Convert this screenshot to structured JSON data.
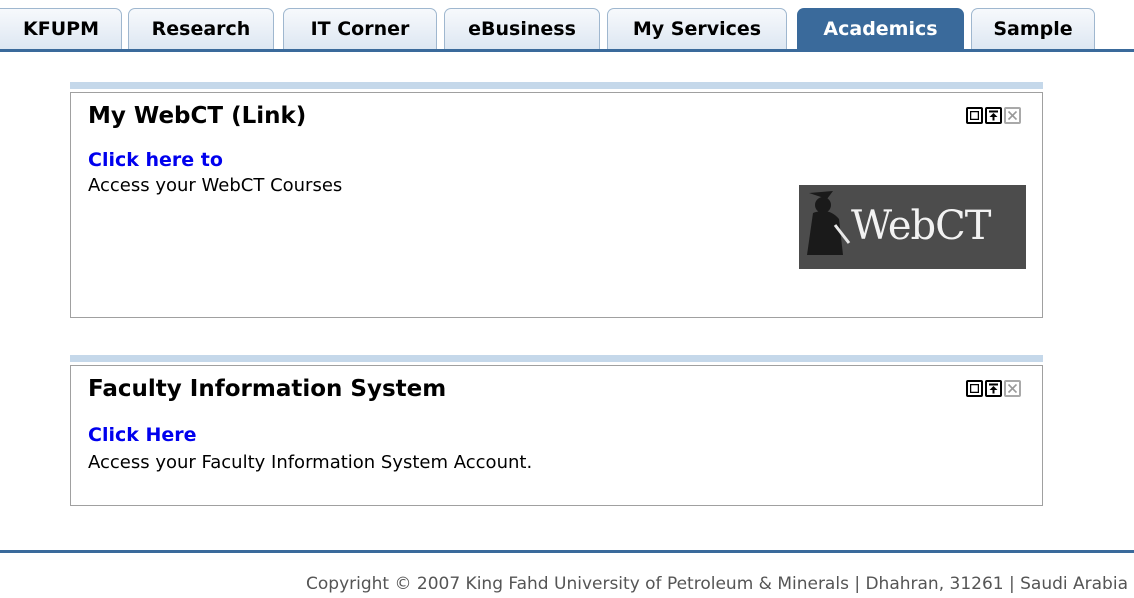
{
  "tabs": [
    {
      "label": "KFUPM"
    },
    {
      "label": "Research"
    },
    {
      "label": "IT Corner"
    },
    {
      "label": "eBusiness"
    },
    {
      "label": "My Services"
    },
    {
      "label": "Academics"
    },
    {
      "label": "Sample"
    }
  ],
  "active_tab": "Academics",
  "portlets": [
    {
      "title": "My WebCT (Link)",
      "link_text": "Click here to",
      "description": "Access your WebCT Courses",
      "logo_text": "WebCT",
      "controls": [
        "minimize-icon",
        "maximize-icon",
        "close-icon"
      ]
    },
    {
      "title": "Faculty Information System",
      "link_text": "Click Here",
      "description": "Access your Faculty Information System Account.",
      "controls": [
        "minimize-icon",
        "maximize-icon",
        "close-icon"
      ]
    }
  ],
  "footer": {
    "text": "Copyright © 2007 King Fahd University of Petroleum & Minerals | Dhahran, 31261 | Saudi Arabia"
  },
  "colors": {
    "tab_active": "#3a6a9b",
    "tab_inactive": "#dde7f2",
    "portlet_bar": "#c5d8ea",
    "link": "#0000ee"
  }
}
